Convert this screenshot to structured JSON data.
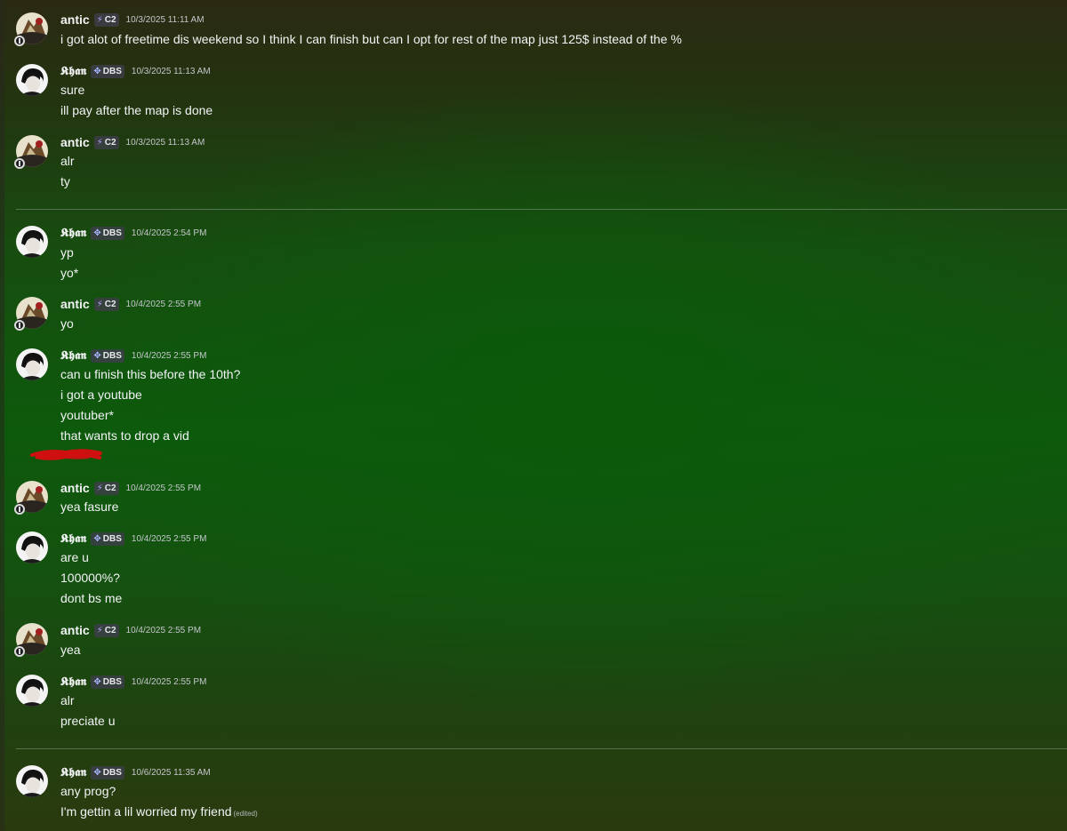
{
  "users": {
    "antic": {
      "name": "antic",
      "tag": "C2",
      "tag_icon": "lightning-icon"
    },
    "khan": {
      "name": "𝕶𝖍𝖆𝖓",
      "tag": "DBS",
      "tag_icon": "compass-icon"
    }
  },
  "groups": [
    {
      "user": "antic",
      "timestamp": "10/3/2025 11:11 AM",
      "lines": [
        "i got alot of freetime dis weekend so I think I can finish but can I opt for rest of the map just 125$ instead of the %"
      ]
    },
    {
      "user": "khan",
      "timestamp": "10/3/2025 11:13 AM",
      "lines": [
        "sure",
        "ill pay after the map is done"
      ]
    },
    {
      "user": "antic",
      "timestamp": "10/3/2025 11:13 AM",
      "lines": [
        "alr",
        "ty"
      ]
    },
    {
      "user": "khan",
      "timestamp": "10/4/2025 2:54 PM",
      "lines": [
        "yp",
        "yo*"
      ]
    },
    {
      "user": "antic",
      "timestamp": "10/4/2025 2:55 PM",
      "lines": [
        "yo"
      ]
    },
    {
      "user": "khan",
      "timestamp": "10/4/2025 2:55 PM",
      "lines": [
        "can u finish this before the 10th?",
        "i got a youtube",
        "youtuber*",
        "that wants to drop a vid"
      ]
    },
    {
      "user": "antic",
      "timestamp": "10/4/2025 2:55 PM",
      "lines": [
        "yea fasure"
      ]
    },
    {
      "user": "khan",
      "timestamp": "10/4/2025 2:55 PM",
      "lines": [
        "are u",
        "100000%?",
        "dont bs me"
      ]
    },
    {
      "user": "antic",
      "timestamp": "10/4/2025 2:55 PM",
      "lines": [
        "yea"
      ]
    },
    {
      "user": "khan",
      "timestamp": "10/4/2025 2:55 PM",
      "lines": [
        "alr",
        "preciate u"
      ]
    },
    {
      "user": "khan",
      "timestamp": "10/6/2025 11:35 AM",
      "lines": [
        "any prog?",
        "I'm gettin a lil worried my friend"
      ],
      "edited_label": "(edited)"
    }
  ],
  "colors": {
    "redaction": "#d01010",
    "background_green": "#0d5a0c"
  }
}
